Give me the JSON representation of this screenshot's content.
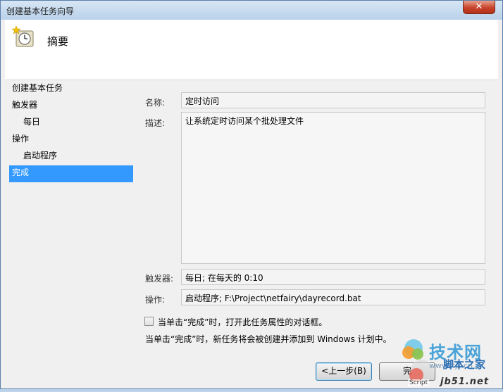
{
  "window": {
    "title": "创建基本任务向导",
    "close_glyph": "✕"
  },
  "header": {
    "icon": "clock-icon",
    "title": "摘要"
  },
  "nav": {
    "items": [
      {
        "label": "创建基本任务",
        "indent": false,
        "selected": false
      },
      {
        "label": "触发器",
        "indent": false,
        "selected": false
      },
      {
        "label": "每日",
        "indent": true,
        "selected": false
      },
      {
        "label": "操作",
        "indent": false,
        "selected": false
      },
      {
        "label": "启动程序",
        "indent": true,
        "selected": false
      },
      {
        "label": "完成",
        "indent": false,
        "selected": true
      }
    ]
  },
  "form": {
    "name_label": "名称:",
    "name_value": "定时访问",
    "desc_label": "描述:",
    "desc_value": "让系统定时访问某个批处理文件",
    "trigger_label": "触发器:",
    "trigger_value": "每日; 在每天的 0:10",
    "action_label": "操作:",
    "action_value": "启动程序; F:\\Project\\netfairy\\dayrecord.bat",
    "open_props_checkbox_label": "当单击“完成”时，打开此任务属性的对话框。",
    "open_props_checked": false,
    "finish_note": "当单击“完成”时，新任务将会被创建并添加到 Windows 计划中。"
  },
  "buttons": {
    "back_label": "<上一步(B)",
    "finish_label": "完"
  },
  "watermark": {
    "site_name": "技术网",
    "sub_name": "脚本之家",
    "domain_text": "jb51.net",
    "script_tag": "Script",
    "url_fragment": "www.itjs.cn"
  }
}
